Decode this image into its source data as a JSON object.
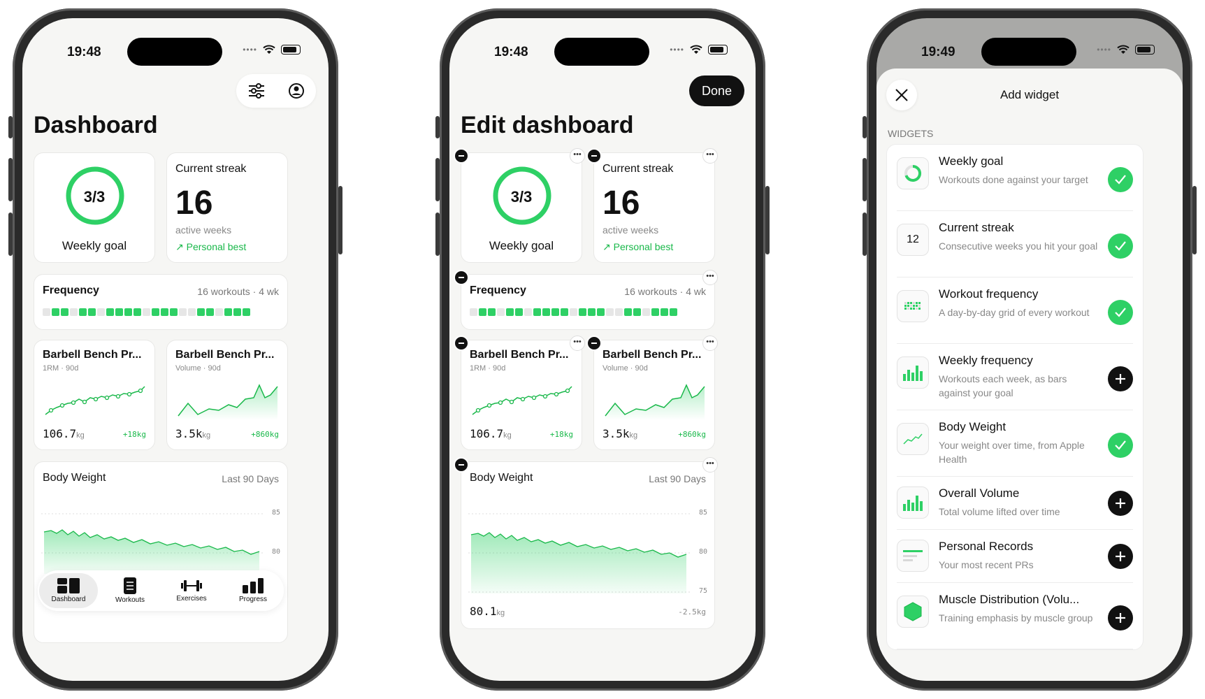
{
  "phones": {
    "dashboard": {
      "time": "19:48",
      "title": "Dashboard",
      "weekly_goal": {
        "value": "3/3",
        "label": "Weekly goal",
        "progress": 1.0
      },
      "streak": {
        "title": "Current streak",
        "value": "16",
        "unit": "active weeks",
        "badge": "↗ Personal best"
      },
      "frequency": {
        "title": "Frequency",
        "meta": "16 workouts · 4 wk"
      },
      "bench_1rm": {
        "title": "Barbell Bench Pr...",
        "sub": "1RM · 90d",
        "value": "106.7",
        "unit": "kg",
        "delta": "+18kg"
      },
      "bench_vol": {
        "title": "Barbell Bench Pr...",
        "sub": "Volume · 90d",
        "value": "3.5k",
        "unit": "kg",
        "delta": "+860kg"
      },
      "body_weight": {
        "title": "Body Weight",
        "meta": "Last 90 Days",
        "tick_85": "85",
        "tick_80": "80"
      },
      "tabs": [
        {
          "label": "Dashboard",
          "icon": "dashboard-icon"
        },
        {
          "label": "Workouts",
          "icon": "workouts-icon"
        },
        {
          "label": "Exercises",
          "icon": "exercises-icon"
        },
        {
          "label": "Progress",
          "icon": "progress-icon"
        }
      ]
    },
    "edit": {
      "time": "19:48",
      "done_label": "Done",
      "title": "Edit dashboard",
      "body_weight": {
        "tick_75": "75",
        "value": "80.1",
        "unit": "kg",
        "delta": "-2.5kg"
      }
    },
    "add": {
      "time": "19:49",
      "title": "Add widget",
      "section": "WIDGETS",
      "widgets": [
        {
          "title": "Weekly goal",
          "desc": "Workouts done against your target",
          "added": true,
          "icon": "ring-icon"
        },
        {
          "title": "Current streak",
          "desc": "Consecutive weeks you hit your goal",
          "added": true,
          "icon": "number-icon",
          "icon_text": "12"
        },
        {
          "title": "Workout frequency",
          "desc": "A day-by-day grid of every workout",
          "added": true,
          "icon": "grid-icon"
        },
        {
          "title": "Weekly frequency",
          "desc": "Workouts each week, as bars against your goal",
          "added": false,
          "icon": "bars-icon"
        },
        {
          "title": "Body Weight",
          "desc": "Your weight over time, from Apple Health",
          "added": true,
          "icon": "line-chart-icon"
        },
        {
          "title": "Overall Volume",
          "desc": "Total volume lifted over time",
          "added": false,
          "icon": "bars-icon"
        },
        {
          "title": "Personal Records",
          "desc": "Your most recent PRs",
          "added": false,
          "icon": "list-icon"
        },
        {
          "title": "Muscle Distribution (Volu...",
          "desc": "Training emphasis by muscle group",
          "added": false,
          "icon": "hexagon-icon"
        }
      ]
    }
  },
  "frequency_pattern": [
    0,
    1,
    1,
    0,
    1,
    1,
    0,
    1,
    1,
    1,
    1,
    0,
    1,
    1,
    1,
    0,
    0,
    1,
    1,
    0,
    1,
    1,
    1
  ],
  "colors": {
    "accent": "#2ed065",
    "dark": "#111111"
  }
}
